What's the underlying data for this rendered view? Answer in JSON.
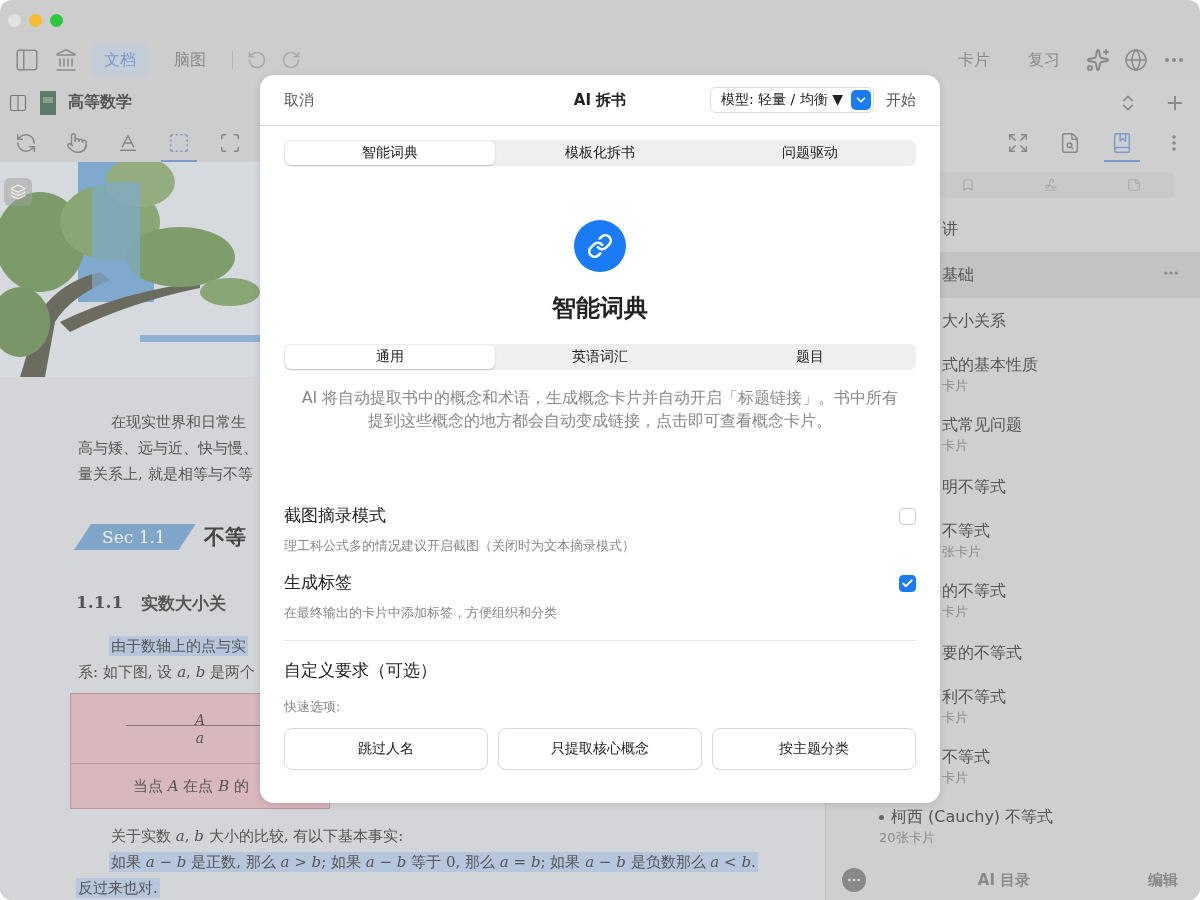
{
  "toolbar": {
    "tabs": [
      {
        "label": "文档",
        "selected": true
      },
      {
        "label": "脑图",
        "selected": false
      }
    ],
    "right_items": [
      "卡片",
      "复习"
    ]
  },
  "document": {
    "title": "高等数学",
    "tools": [
      {
        "kind": "sync",
        "selected": false
      },
      {
        "kind": "hand",
        "selected": false
      },
      {
        "kind": "text",
        "selected": false
      },
      {
        "kind": "rect",
        "selected": true
      },
      {
        "kind": "resize",
        "selected": false
      }
    ],
    "lines": [
      {
        "text": "在现实世界和日常生",
        "kind": "indent",
        "highlighted": false
      },
      {
        "text": "高与矮、远与近、快与慢、",
        "kind": "plain",
        "highlighted": false
      },
      {
        "text": "量关系上, 就是相等与不等",
        "kind": "plain",
        "highlighted": false
      }
    ],
    "section_badge": "Sec 1.1",
    "section_title": "不等",
    "subsection_number": "1.1.1",
    "subsection_title": "实数大小关",
    "lines_2": [
      {
        "text": "由于数轴上的点与实",
        "kind": "indent",
        "highlighted": true
      },
      {
        "text": "系: 如下图, 设 *a*, *b* 是两个",
        "kind": "plain",
        "highlighted": false
      }
    ],
    "figure": {
      "point_label": "*A*",
      "point_value": "*a*",
      "caption": "当点 *A* 在点 *B* 的"
    },
    "lines_3": [
      {
        "text": "关于实数 *a*, *b* 大小的比较, 有以下基本事实:",
        "kind": "indent",
        "highlighted": false
      },
      {
        "text": "如果 *a* − *b* 是正数, 那么 *a* > *b*; 如果 *a* − *b* 等于 0, 那么 *a* = *b*; 如果 *a* − *b* 是负数那么 *a* < *b*.",
        "kind": "indent",
        "highlighted": true
      },
      {
        "text": "反过来也对.",
        "kind": "plain",
        "highlighted": true
      }
    ]
  },
  "outline": {
    "tools": [
      {
        "kind": "expand",
        "selected": false
      },
      {
        "kind": "search",
        "selected": false
      },
      {
        "kind": "bookmark",
        "selected": true
      },
      {
        "kind": "more",
        "selected": false
      }
    ],
    "items": [
      {
        "title": "讲",
        "kind": "clipped",
        "selected": false
      },
      {
        "title": "基础",
        "kind": "clipped",
        "selected": true
      },
      {
        "title": "大小关系",
        "kind": "clipped",
        "selected": false
      },
      {
        "title": "式的基本性质",
        "count": "卡片",
        "kind": "clipped",
        "selected": false
      },
      {
        "title": "式常见问题",
        "count": "卡片",
        "kind": "clipped",
        "selected": false
      },
      {
        "title": "明不等式",
        "kind": "clipped",
        "selected": false
      },
      {
        "title": "不等式",
        "count": "张卡片",
        "kind": "clipped",
        "selected": false
      },
      {
        "title": "的不等式",
        "count": "卡片",
        "kind": "clipped",
        "selected": false
      },
      {
        "title": "要的不等式",
        "kind": "clipped",
        "selected": false
      },
      {
        "title": "利不等式",
        "count": "卡片",
        "kind": "clipped",
        "selected": false
      },
      {
        "title": "不等式",
        "count": "卡片",
        "kind": "clipped",
        "selected": false
      },
      {
        "title": "柯西 (Cauchy) 不等式",
        "count": "20张卡片",
        "kind": "bullet",
        "selected": false
      }
    ],
    "ai_button": "AI 目录",
    "edit_button": "编辑"
  },
  "dialog": {
    "cancel": "取消",
    "title": "AI 拆书",
    "model_select": "模型: 轻量 / 均衡 ▼",
    "start": "开始",
    "modes": [
      {
        "label": "智能词典",
        "selected": true
      },
      {
        "label": "模板化拆书",
        "selected": false
      },
      {
        "label": "问题驱动",
        "selected": false
      }
    ],
    "feature_title": "智能词典",
    "kinds": [
      {
        "label": "通用",
        "selected": true
      },
      {
        "label": "英语词汇",
        "selected": false
      },
      {
        "label": "题目",
        "selected": false
      }
    ],
    "description": "AI 将自动提取书中的概念和术语，生成概念卡片并自动开启「标题链接」。书中所有提到这些概念的地方都会自动变成链接，点击即可查看概念卡片。",
    "options": [
      {
        "title": "截图摘录模式",
        "hint": "理工科公式多的情况建议开启截图（关闭时为文本摘录模式）",
        "checked": false
      },
      {
        "title": "生成标签",
        "hint": "在最终输出的卡片中添加标签，方便组织和分类",
        "checked": true
      }
    ],
    "custom_title": "自定义要求（可选）",
    "quick_label": "快速选项:",
    "quick_options": [
      "跳过人名",
      "只提取核心概念",
      "按主题分类"
    ]
  }
}
